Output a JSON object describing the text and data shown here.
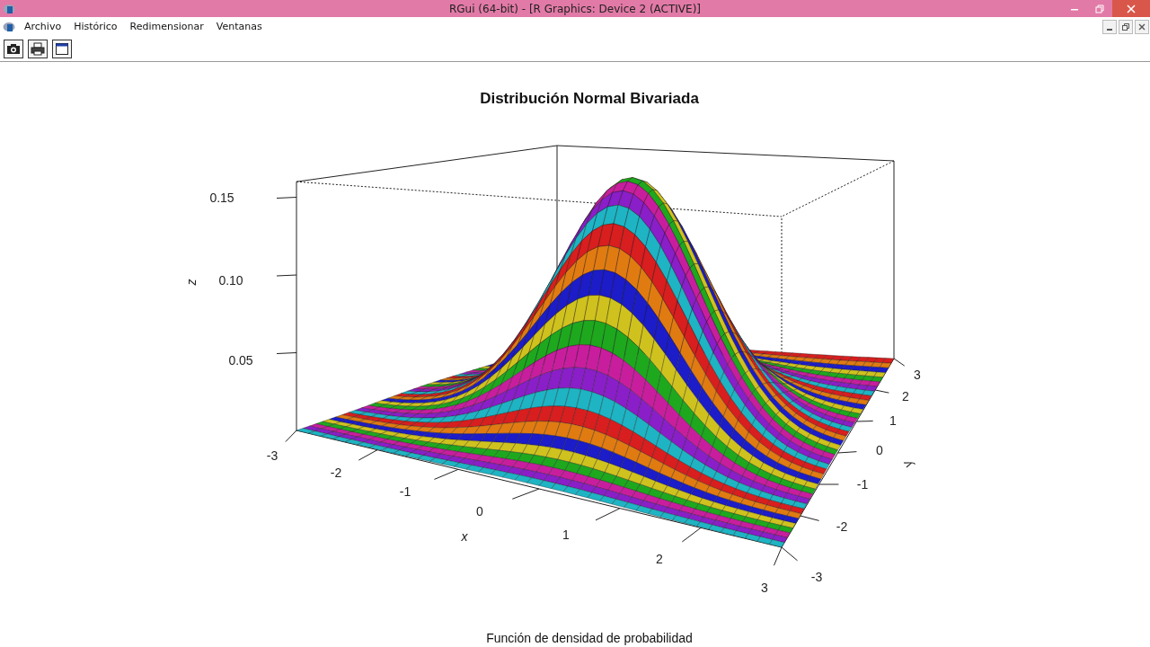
{
  "window": {
    "title": "RGui (64-bit) - [R Graphics: Device 2 (ACTIVE)]"
  },
  "menu": [
    "Archivo",
    "Histórico",
    "Redimensionar",
    "Ventanas"
  ],
  "toolbar": [
    {
      "kind": "camera"
    },
    {
      "kind": "print"
    },
    {
      "kind": "window"
    }
  ],
  "plot": {
    "title": "Distribución Normal Bivariada",
    "subtitle": "Función de densidad de probabilidad",
    "xlabel": "x",
    "ylabel": "y",
    "zlabel": "z",
    "xticks": [
      "-3",
      "-2",
      "-1",
      "0",
      "1",
      "2",
      "3"
    ],
    "yticks": [
      "-3",
      "-2",
      "-1",
      "0",
      "1",
      "2",
      "3"
    ],
    "zticks": [
      "0.05",
      "0.10",
      "0.15"
    ]
  }
}
